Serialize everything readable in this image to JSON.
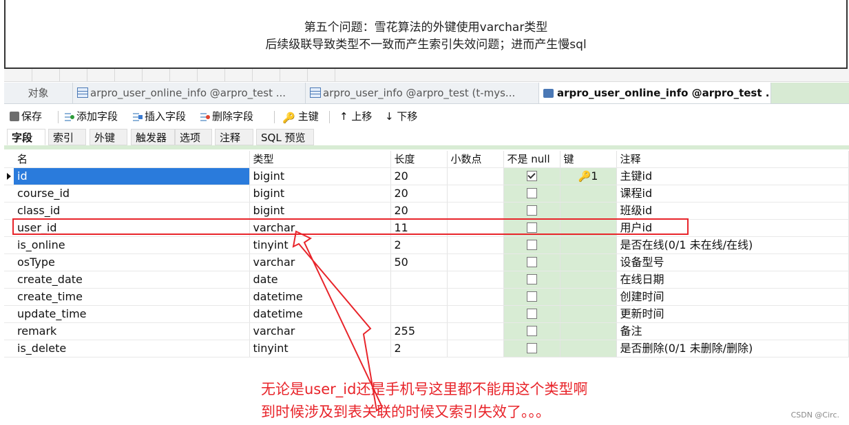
{
  "note": {
    "line1": "第五个问题：雪花算法的外键使用varchar类型",
    "line2": "后续级联导致类型不一致而产生索引失效问题；进而产生慢sql"
  },
  "tabs": {
    "objects": "对象",
    "tab1": "arpro_user_online_info @arpro_test ...",
    "tab2": "arpro_user_info @arpro_test (t-mys...",
    "tab3": "arpro_user_online_info @arpro_test ..."
  },
  "toolbar": {
    "save": "保存",
    "add_field": "添加字段",
    "insert_field": "插入字段",
    "delete_field": "删除字段",
    "primary_key": "主键",
    "move_up": "上移",
    "move_down": "下移"
  },
  "subtabs": [
    "字段",
    "索引",
    "外键",
    "触发器",
    "选项",
    "注释",
    "SQL 预览"
  ],
  "columns": [
    "名",
    "类型",
    "长度",
    "小数点",
    "不是 null",
    "键",
    "注释"
  ],
  "rows": [
    {
      "name": "id",
      "type": "bigint",
      "length": "20",
      "decimal": "",
      "not_null": true,
      "key": "1",
      "comment": "主键id"
    },
    {
      "name": "course_id",
      "type": "bigint",
      "length": "20",
      "decimal": "",
      "not_null": false,
      "key": "",
      "comment": "课程id"
    },
    {
      "name": "class_id",
      "type": "bigint",
      "length": "20",
      "decimal": "",
      "not_null": false,
      "key": "",
      "comment": "班级id"
    },
    {
      "name": "user_id",
      "type": "varchar",
      "length": "11",
      "decimal": "",
      "not_null": false,
      "key": "",
      "comment": "用户id"
    },
    {
      "name": "is_online",
      "type": "tinyint",
      "length": "2",
      "decimal": "",
      "not_null": false,
      "key": "",
      "comment": "是否在线(0/1 未在线/在线)"
    },
    {
      "name": "osType",
      "type": "varchar",
      "length": "50",
      "decimal": "",
      "not_null": false,
      "key": "",
      "comment": "设备型号"
    },
    {
      "name": "create_date",
      "type": "date",
      "length": "",
      "decimal": "",
      "not_null": false,
      "key": "",
      "comment": "在线日期"
    },
    {
      "name": "create_time",
      "type": "datetime",
      "length": "",
      "decimal": "",
      "not_null": false,
      "key": "",
      "comment": "创建时间"
    },
    {
      "name": "update_time",
      "type": "datetime",
      "length": "",
      "decimal": "",
      "not_null": false,
      "key": "",
      "comment": "更新时间"
    },
    {
      "name": "remark",
      "type": "varchar",
      "length": "255",
      "decimal": "",
      "not_null": false,
      "key": "",
      "comment": "备注"
    },
    {
      "name": "is_delete",
      "type": "tinyint",
      "length": "2",
      "decimal": "",
      "not_null": false,
      "key": "",
      "comment": "是否删除(0/1 未删除/删除)"
    }
  ],
  "annotation": {
    "line1": "无论是user_id还是手机号这里都不能用这个类型啊",
    "line2": "到时候涉及到表关联的时候又索引失效了。。。"
  },
  "watermark": "CSDN @Circ.",
  "colors": {
    "annotation_red": "#e8242a",
    "selection_blue": "#2a7bdc",
    "notnull_green": "#d8ecd4"
  }
}
